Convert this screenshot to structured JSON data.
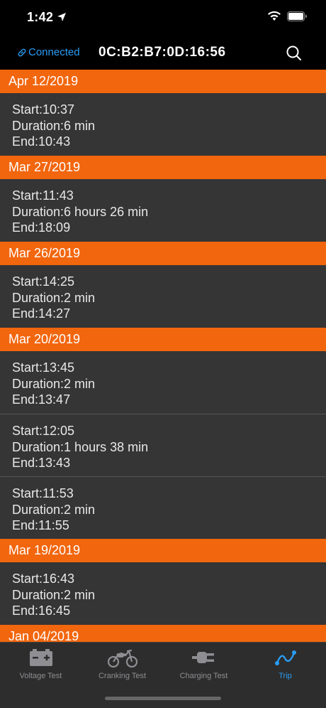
{
  "status_bar": {
    "time": "1:42"
  },
  "header": {
    "connection_status": "Connected",
    "device_id": "0C:B2:B7:0D:16:56"
  },
  "labels": {
    "start": "Start:",
    "duration": "Duration:",
    "end": "End:"
  },
  "trips": [
    {
      "date": "Apr 12/2019",
      "entries": [
        {
          "start": "10:37",
          "duration": "6 min",
          "end": "10:43"
        }
      ]
    },
    {
      "date": "Mar 27/2019",
      "entries": [
        {
          "start": "11:43",
          "duration": "6 hours 26 min",
          "end": "18:09"
        }
      ]
    },
    {
      "date": "Mar 26/2019",
      "entries": [
        {
          "start": "14:25",
          "duration": "2 min",
          "end": "14:27"
        }
      ]
    },
    {
      "date": "Mar 20/2019",
      "entries": [
        {
          "start": "13:45",
          "duration": "2 min",
          "end": "13:47"
        },
        {
          "start": "12:05",
          "duration": "1 hours 38 min",
          "end": "13:43"
        },
        {
          "start": "11:53",
          "duration": "2 min",
          "end": "11:55"
        }
      ]
    },
    {
      "date": "Mar 19/2019",
      "entries": [
        {
          "start": "16:43",
          "duration": "2 min",
          "end": "16:45"
        }
      ]
    },
    {
      "date": "Jan 04/2019",
      "entries": []
    }
  ],
  "tabs": [
    {
      "label": "Voltage Test",
      "icon": "battery-icon"
    },
    {
      "label": "Cranking Test",
      "icon": "motorcycle-icon"
    },
    {
      "label": "Charging Test",
      "icon": "plug-icon"
    },
    {
      "label": "Trip",
      "icon": "route-icon",
      "active": true
    }
  ],
  "colors": {
    "accent": "#f2660e",
    "link": "#2a9df4",
    "row_bg": "#353535",
    "tab_bg": "#2d2d2d"
  }
}
